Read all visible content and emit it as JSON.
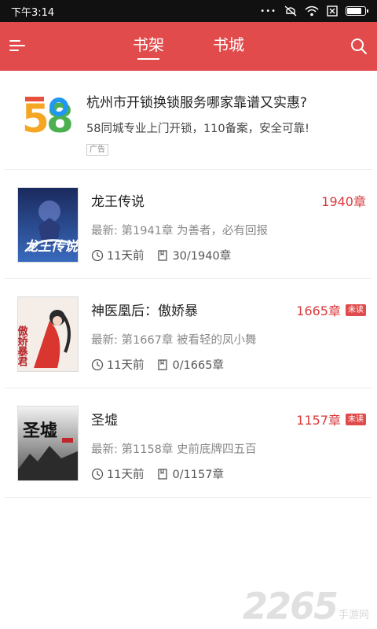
{
  "status_bar": {
    "time": "下午3:14",
    "dots": "•••",
    "icons": [
      "silent-icon",
      "wifi-icon",
      "close-box-icon",
      "battery-icon"
    ],
    "battery_level": 0.85
  },
  "app_bar": {
    "tabs": [
      {
        "label": "书架",
        "active": true
      },
      {
        "label": "书城",
        "active": false
      }
    ],
    "background": "#e24b4c"
  },
  "ad": {
    "logo_text": "58",
    "title": "杭州市开锁换锁服务哪家靠谱又实惠?",
    "description": "58同城专业上门开锁，110备案，安全可靠!",
    "tag": "广告"
  },
  "books": [
    {
      "title": "龙王传说",
      "chapters": "1940章",
      "unread": "",
      "latest": "最新: 第1941章 为善者，必有回报",
      "updated": "11天前",
      "progress": "30/1940章",
      "cover_text": "龙王传说"
    },
    {
      "title": "神医凰后：傲娇暴",
      "chapters": "1665章",
      "unread": "未读",
      "latest": "最新: 第1667章 被看轻的凤小舞",
      "updated": "11天前",
      "progress": "0/1665章",
      "cover_text": "傲娇暴君"
    },
    {
      "title": "圣墟",
      "chapters": "1157章",
      "unread": "未读",
      "latest": "最新: 第1158章 史前底牌四五百",
      "updated": "11天前",
      "progress": "0/1157章",
      "cover_text": "圣墟"
    }
  ],
  "watermark": {
    "number": "2265",
    "text": "手游网"
  },
  "colors": {
    "accent": "#e24b4c",
    "chapter_red": "#d93b3d"
  }
}
